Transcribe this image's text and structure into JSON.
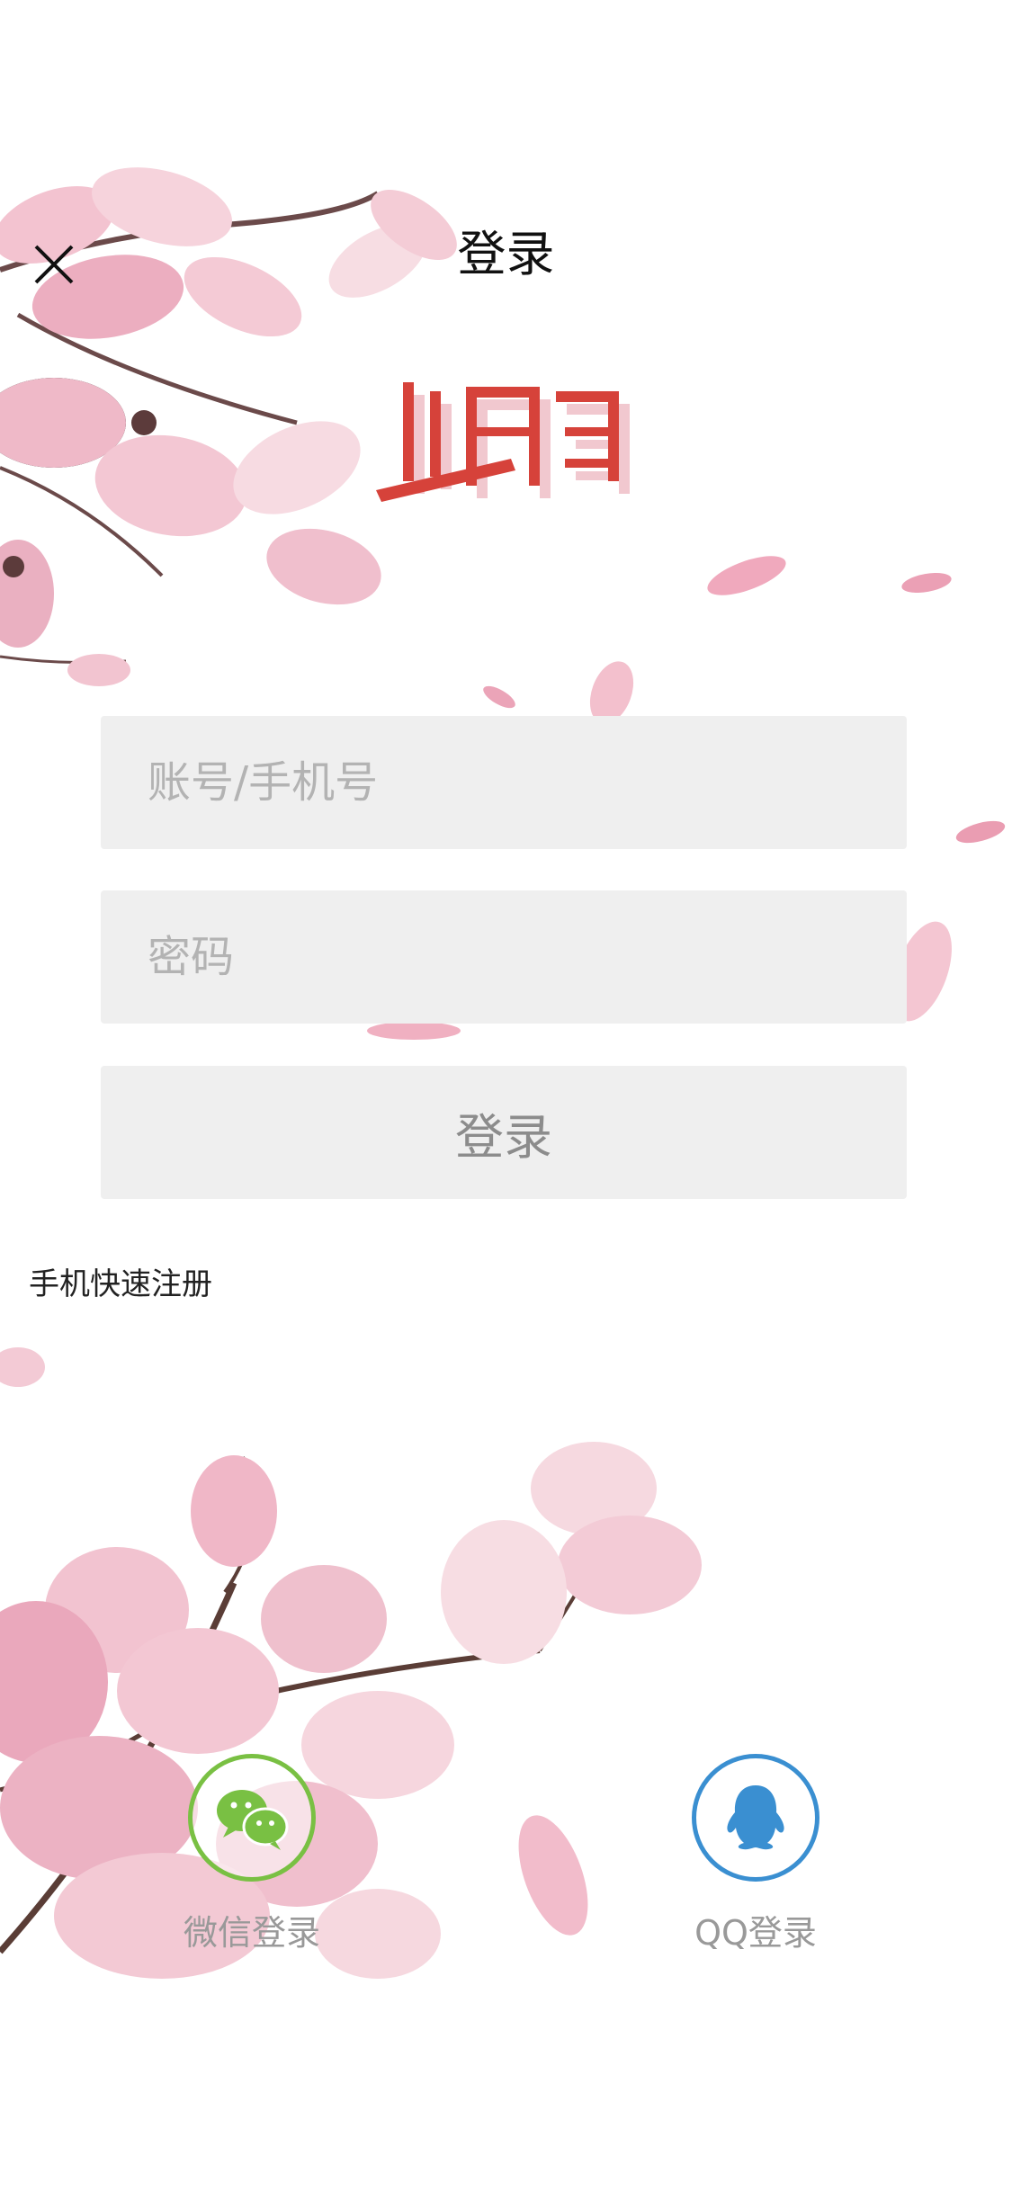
{
  "header": {
    "title": "登录"
  },
  "login_form": {
    "account_placeholder": "账号/手机号",
    "password_placeholder": "密码",
    "submit_label": "登录"
  },
  "register": {
    "label": "手机快速注册"
  },
  "social_login": [
    {
      "label": "微信登录",
      "icon": "wechat-icon",
      "color": "#79c043"
    },
    {
      "label": "QQ登录",
      "icon": "qq-icon",
      "color": "#3a8fd1"
    }
  ],
  "colors": {
    "field_bg": "#efefef",
    "logo_red": "#d6423a",
    "petal_pink": "#f2b9c8"
  }
}
